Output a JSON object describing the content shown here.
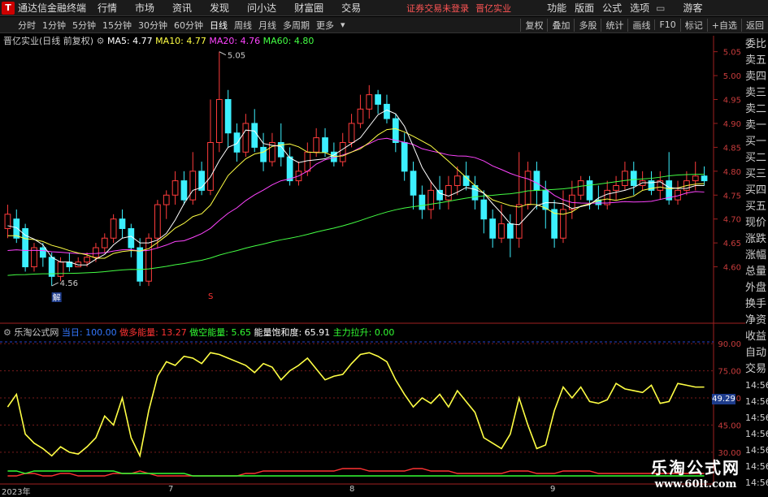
{
  "titlebar": {
    "app_name": "通达信金融终端",
    "menus": [
      "行情",
      "市场",
      "资讯",
      "发现",
      "问小达",
      "财富圈",
      "交易"
    ],
    "status": "证券交易未登录",
    "stock": "晋亿实业",
    "right_menus": [
      "功能",
      "版面",
      "公式",
      "选项"
    ],
    "user": "游客"
  },
  "toolbar": {
    "periods": [
      "分时",
      "1分钟",
      "5分钟",
      "15分钟",
      "30分钟",
      "60分钟",
      "日线",
      "周线",
      "月线",
      "多周期",
      "更多"
    ],
    "active": "日线",
    "tools": [
      "复权",
      "叠加",
      "多股",
      "统计",
      "画线",
      "F10",
      "标记",
      "+自选",
      "返回"
    ]
  },
  "main": {
    "stock_label": "晋亿实业(日线 前复权)",
    "ma": [
      {
        "label": "MA5: 4.77",
        "color": "#ffffff"
      },
      {
        "label": "MA10: 4.77",
        "color": "#ffff44"
      },
      {
        "label": "MA20: 4.76",
        "color": "#ff44ff"
      },
      {
        "label": "MA60: 4.80",
        "color": "#44ff44"
      }
    ],
    "high_mark": "5.05",
    "low_mark": "4.56",
    "low_tag": "解",
    "s_mark": "S"
  },
  "ind": {
    "name": "乐淘公式网",
    "items": [
      {
        "label": "当日: 100.00",
        "color": "#3377ff"
      },
      {
        "label": "做多能量: 13.27",
        "color": "#ff3333"
      },
      {
        "label": "做空能量: 5.65",
        "color": "#33ff33"
      },
      {
        "label": "能量饱和度: 65.91",
        "color": "#ffffff"
      },
      {
        "label": "主力拉升: 0.00",
        "color": "#33ff33"
      }
    ],
    "badge": "49.29"
  },
  "sidebar": [
    "委比",
    "卖五",
    "卖四",
    "卖三",
    "卖二",
    "卖一",
    "买一",
    "买二",
    "买三",
    "买四",
    "买五",
    "现价",
    "涨跌",
    "涨幅",
    "总量",
    "外盘",
    "换手",
    "净资",
    "收益",
    "自动",
    "交易",
    "14:56",
    "14:56",
    "14:56",
    "14:56",
    "14:56",
    "14:56",
    "14:56"
  ],
  "dates": [
    "2023年",
    "7",
    "8",
    "9"
  ],
  "watermark": {
    "line1": "乐淘公式网",
    "line2": "www.60lt.com"
  },
  "colors": {
    "up": "#ff3c3c",
    "down": "#3cf0ff",
    "ma5": "#ffffff",
    "ma10": "#ffff44",
    "ma20": "#ff44ff",
    "ma60": "#44ff44",
    "ind": "#ffff44"
  },
  "chart_data": {
    "type": "candlestick",
    "y_axis": [
      "5.05",
      "5.00",
      "4.95",
      "4.90",
      "4.85",
      "4.80",
      "4.75",
      "4.70",
      "4.65",
      "4.60"
    ],
    "ind_axis": [
      "90.00",
      "75.00",
      "60.00",
      "45.00",
      "30.00"
    ],
    "candles": [
      [
        4.68,
        4.71,
        4.73,
        4.66
      ],
      [
        4.7,
        4.66,
        4.72,
        4.65
      ],
      [
        4.68,
        4.6,
        4.69,
        4.59
      ],
      [
        4.6,
        4.64,
        4.65,
        4.59
      ],
      [
        4.64,
        4.62,
        4.65,
        4.6
      ],
      [
        4.62,
        4.58,
        4.63,
        4.56
      ],
      [
        4.58,
        4.61,
        4.62,
        4.57
      ],
      [
        4.61,
        4.6,
        4.63,
        4.59
      ],
      [
        4.6,
        4.61,
        4.62,
        4.6
      ],
      [
        4.61,
        4.62,
        4.63,
        4.6
      ],
      [
        4.62,
        4.64,
        4.65,
        4.61
      ],
      [
        4.64,
        4.66,
        4.67,
        4.63
      ],
      [
        4.66,
        4.7,
        4.71,
        4.65
      ],
      [
        4.7,
        4.68,
        4.72,
        4.66
      ],
      [
        4.68,
        4.64,
        4.69,
        4.62
      ],
      [
        4.64,
        4.57,
        4.66,
        4.56
      ],
      [
        4.57,
        4.66,
        4.67,
        4.56
      ],
      [
        4.66,
        4.73,
        4.74,
        4.64
      ],
      [
        4.73,
        4.75,
        4.76,
        4.7
      ],
      [
        4.75,
        4.78,
        4.8,
        4.73
      ],
      [
        4.78,
        4.74,
        4.8,
        4.73
      ],
      [
        4.74,
        4.8,
        4.84,
        4.73
      ],
      [
        4.8,
        4.76,
        4.82,
        4.75
      ],
      [
        4.76,
        4.86,
        4.95,
        4.75
      ],
      [
        4.86,
        4.95,
        5.05,
        4.84
      ],
      [
        4.95,
        4.88,
        4.97,
        4.85
      ],
      [
        4.88,
        4.84,
        4.9,
        4.82
      ],
      [
        4.84,
        4.9,
        4.92,
        4.83
      ],
      [
        4.9,
        4.85,
        4.93,
        4.84
      ],
      [
        4.85,
        4.82,
        4.88,
        4.8
      ],
      [
        4.82,
        4.86,
        4.88,
        4.81
      ],
      [
        4.86,
        4.83,
        4.9,
        4.81
      ],
      [
        4.83,
        4.78,
        4.85,
        4.77
      ],
      [
        4.78,
        4.8,
        4.82,
        4.77
      ],
      [
        4.8,
        4.84,
        4.86,
        4.79
      ],
      [
        4.84,
        4.87,
        4.89,
        4.83
      ],
      [
        4.87,
        4.84,
        4.89,
        4.83
      ],
      [
        4.84,
        4.82,
        4.86,
        4.81
      ],
      [
        4.82,
        4.86,
        4.88,
        4.81
      ],
      [
        4.86,
        4.9,
        4.92,
        4.85
      ],
      [
        4.9,
        4.93,
        4.96,
        4.89
      ],
      [
        4.93,
        4.96,
        4.98,
        4.91
      ],
      [
        4.96,
        4.94,
        4.97,
        4.92
      ],
      [
        4.94,
        4.91,
        4.96,
        4.9
      ],
      [
        4.91,
        4.86,
        4.92,
        4.84
      ],
      [
        4.86,
        4.8,
        4.88,
        4.78
      ],
      [
        4.8,
        4.75,
        4.82,
        4.72
      ],
      [
        4.75,
        4.72,
        4.77,
        4.7
      ],
      [
        4.72,
        4.76,
        4.78,
        4.7
      ],
      [
        4.76,
        4.74,
        4.79,
        4.72
      ],
      [
        4.74,
        4.77,
        4.79,
        4.72
      ],
      [
        4.77,
        4.79,
        4.81,
        4.75
      ],
      [
        4.79,
        4.77,
        4.82,
        4.76
      ],
      [
        4.77,
        4.74,
        4.79,
        4.72
      ],
      [
        4.74,
        4.7,
        4.76,
        4.67
      ],
      [
        4.7,
        4.66,
        4.72,
        4.64
      ],
      [
        4.66,
        4.69,
        4.73,
        4.65
      ],
      [
        4.69,
        4.66,
        4.71,
        4.62
      ],
      [
        4.66,
        4.73,
        4.84,
        4.64
      ],
      [
        4.73,
        4.8,
        4.82,
        4.72
      ],
      [
        4.8,
        4.76,
        4.82,
        4.72
      ],
      [
        4.76,
        4.72,
        4.78,
        4.68
      ],
      [
        4.72,
        4.66,
        4.74,
        4.64
      ],
      [
        4.66,
        4.72,
        4.76,
        4.65
      ],
      [
        4.72,
        4.75,
        4.78,
        4.7
      ],
      [
        4.75,
        4.78,
        4.79,
        4.74
      ],
      [
        4.78,
        4.74,
        4.79,
        4.72
      ],
      [
        4.74,
        4.73,
        4.77,
        4.72
      ],
      [
        4.73,
        4.76,
        4.78,
        4.72
      ],
      [
        4.76,
        4.77,
        4.79,
        4.74
      ],
      [
        4.77,
        4.8,
        4.82,
        4.76
      ],
      [
        4.8,
        4.77,
        4.82,
        4.75
      ],
      [
        4.77,
        4.78,
        4.8,
        4.76
      ],
      [
        4.78,
        4.76,
        4.8,
        4.75
      ],
      [
        4.76,
        4.78,
        4.8,
        4.74
      ],
      [
        4.78,
        4.74,
        4.84,
        4.73
      ],
      [
        4.74,
        4.76,
        4.78,
        4.73
      ],
      [
        4.76,
        4.78,
        4.8,
        4.75
      ],
      [
        4.78,
        4.79,
        4.82,
        4.76
      ],
      [
        4.79,
        4.78,
        4.81,
        4.77
      ]
    ],
    "ind_series": [
      55,
      62,
      40,
      35,
      32,
      28,
      33,
      30,
      29,
      33,
      38,
      50,
      45,
      60,
      38,
      28,
      53,
      72,
      80,
      78,
      83,
      82,
      79,
      85,
      84,
      82,
      80,
      78,
      74,
      79,
      77,
      70,
      75,
      78,
      82,
      76,
      70,
      72,
      73,
      79,
      84,
      85,
      83,
      80,
      70,
      62,
      55,
      60,
      57,
      62,
      55,
      64,
      58,
      52,
      38,
      35,
      32,
      40,
      60,
      45,
      32,
      34,
      53,
      66,
      60,
      66,
      58,
      57,
      59,
      68,
      65,
      64,
      63,
      67,
      57,
      58,
      68,
      67,
      66,
      66
    ],
    "red_series": [
      12,
      12,
      13,
      13,
      12,
      12,
      13,
      13,
      12,
      12,
      12,
      12,
      13,
      13,
      13,
      14,
      13,
      12,
      12,
      12,
      12,
      12,
      12,
      12,
      12,
      12,
      12,
      13,
      13,
      14,
      14,
      14,
      14,
      14,
      14,
      14,
      14,
      14,
      15,
      15,
      15,
      14,
      14,
      14,
      14,
      14,
      15,
      15,
      14,
      14,
      14,
      13,
      13,
      13,
      13,
      13,
      13,
      14,
      14,
      14,
      13,
      13,
      13,
      14,
      14,
      14,
      14,
      13,
      13,
      13,
      13,
      13,
      13,
      13,
      13,
      13,
      13,
      13,
      13,
      13
    ],
    "green_series": [
      14,
      14,
      13,
      14,
      14,
      14,
      14,
      14,
      14,
      14,
      14,
      14,
      14,
      13,
      13,
      13,
      13,
      13,
      13,
      13,
      13,
      12,
      12,
      12,
      12,
      12,
      12,
      12,
      12,
      12,
      12,
      12,
      12,
      12,
      12,
      12,
      12,
      12,
      12,
      12,
      12,
      12,
      12,
      12,
      12,
      12,
      12,
      12,
      12,
      12,
      12,
      12,
      12,
      12,
      12,
      12,
      12,
      12,
      12,
      12,
      12,
      12,
      12,
      12,
      12,
      12,
      12,
      12,
      12,
      12,
      12,
      12,
      12,
      12,
      12,
      12,
      12,
      12,
      12,
      12
    ]
  }
}
